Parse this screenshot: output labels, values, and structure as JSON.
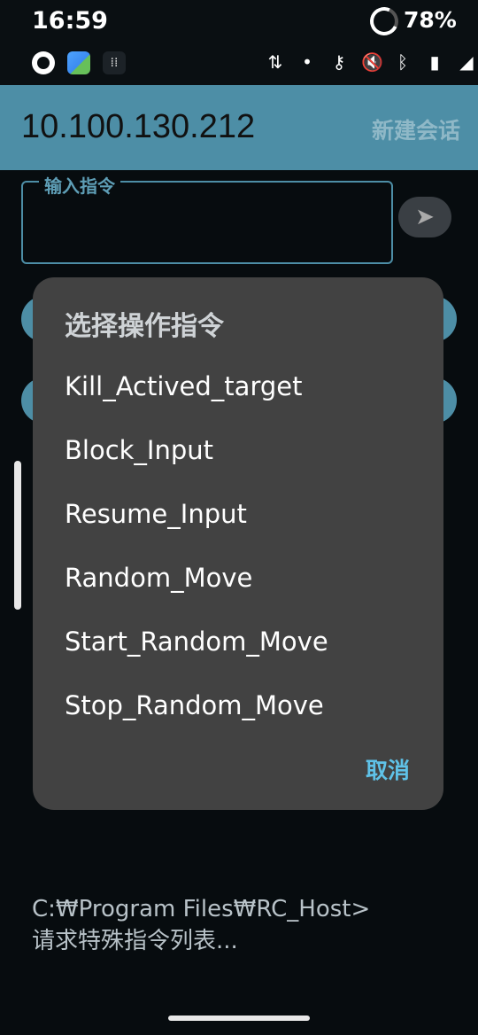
{
  "status_bar": {
    "time": "16:59",
    "battery": "78%",
    "notif_icons": [
      "ubuntu-icon",
      "photos-icon",
      "apps-grid-icon"
    ],
    "system_icons": [
      "data-transfer-icon",
      "dot-icon",
      "vpn-key-icon",
      "mute-icon",
      "bluetooth-icon",
      "signal-icon",
      "wifi-icon"
    ]
  },
  "appbar": {
    "title": "10.100.130.212",
    "action": "新建会话"
  },
  "input": {
    "label": "输入指令",
    "value": ""
  },
  "console": {
    "prompt": "C:₩Program Files₩RC_Host>",
    "message": "请求特殊指令列表..."
  },
  "dialog": {
    "title": "选择操作指令",
    "items": [
      "Kill_Actived_target",
      "Block_Input",
      "Resume_Input",
      "Random_Move",
      "Start_Random_Move",
      "Stop_Random_Move"
    ],
    "cancel": "取消"
  },
  "colors": {
    "accent": "#4d8ea6",
    "dialog_bg": "#424242",
    "cancel_text": "#5fc2e8"
  }
}
